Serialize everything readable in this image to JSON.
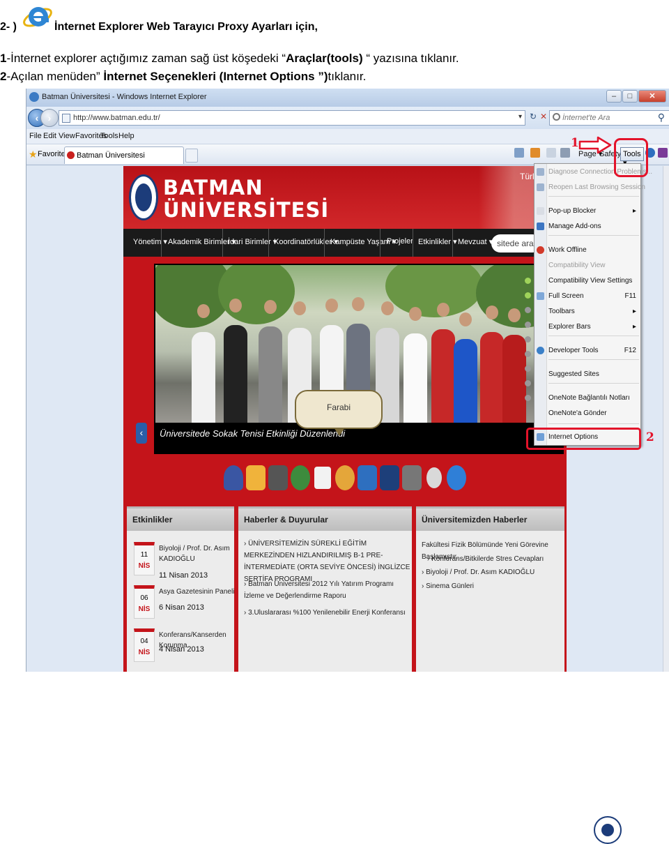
{
  "document": {
    "title_prefix": "2- )",
    "title_text": "İnternet Explorer Web Tarayıcı Proxy Ayarları için,",
    "step1_number": "1",
    "step1_text_a": "-İnternet  explorer  açtığımız zaman sağ üst köşedeki  “",
    "step1_bold": "Araçlar(tools)",
    "step1_text_b": " “ yazısına tıklanır.",
    "step2_number": "2",
    "step2_text_a": "-Açılan menüden” ",
    "step2_bold": "İnternet Seçenekleri (Internet Options ”)",
    "step2_text_b": "tıklanır."
  },
  "browser": {
    "window_title": "Batman Üniversitesi - Windows Internet Explorer",
    "url": "http://www.batman.edu.tr/",
    "search_placeholder": "İnternet'te Ara",
    "menu": [
      "File",
      "Edit",
      "View",
      "Favorites",
      "Tools",
      "Help"
    ],
    "favorites_label": "Favorites",
    "tab_label": "Batman Üniversitesi",
    "commands": {
      "page": "Page ▾",
      "safety": "Safety ▾",
      "tools": "Tools ▾"
    }
  },
  "website": {
    "brand_line1": "BATMAN",
    "brand_line2": "ÜNİVERSİTESİ",
    "language": "Türk",
    "nav": [
      "Yönetim ▾",
      "Akademik Birimler ▾",
      "İdari Birimler ▾",
      "Koordinatörlükler ▾",
      "Kampüste Yaşam ▾",
      "Projeler",
      "Etkinlikler ▾",
      "Mevzuat ▾"
    ],
    "search_placeholder": "sitede ara...",
    "slide_caption": "Üniversitede Sokak Tenisi Etkinliği Düzenlendi",
    "bubble": "Farabi",
    "panels": {
      "events_title": "Etkinlikler",
      "news_title": "Haberler & Duyurular",
      "uni_news_title": "Üniversitemizden Haberler"
    },
    "events": [
      {
        "day": "11",
        "month": "NİS",
        "title": "Biyoloji / Prof. Dr. Asım KADIOĞLU",
        "date": "11 Nisan 2013"
      },
      {
        "day": "06",
        "month": "NİS",
        "title": "Asya Gazetesinin Paneli",
        "date": "6 Nisan 2013"
      },
      {
        "day": "04",
        "month": "NİS",
        "title": "Konferans/Kanserden Korunma",
        "date": "4 Nisan 2013"
      }
    ],
    "news": [
      "› ÜNİVERSİTEMİZİN SÜREKLİ EĞİTİM MERKEZİNDEN HIZLANDIRILMIŞ B-1 PRE-İNTERMEDİATE (ORTA SEVİYE ÖNCESİ) İNGLİZCE SERTİFA PROGRAMI",
      "› Batman Üniversitesi 2012 Yılı Yatırım Programı İzleme ve Değerlendirme Raporu",
      "› 3.Uluslararası %100 Yenilenebilir Enerji Konferansı"
    ],
    "uni_news": [
      "Fakültesi Fizik Bölümünde Yeni Görevine Başlamıştır.",
      "› Konferans/Bitkilerde Stres Cevapları",
      "› Biyoloji / Prof. Dr. Asım KADIOĞLU",
      "› Sinema Günleri"
    ]
  },
  "tools_menu": {
    "items": [
      {
        "label": "Diagnose Connection Problems...",
        "disabled": true
      },
      {
        "label": "Reopen Last Browsing Session",
        "disabled": true
      },
      {
        "label": "Pop-up Blocker",
        "arrow": "▸"
      },
      {
        "label": "Manage Add-ons"
      },
      {
        "label": "Work Offline"
      },
      {
        "label": "Compatibility View",
        "disabled": true
      },
      {
        "label": "Compatibility View Settings"
      },
      {
        "label": "Full Screen",
        "shortcut": "F11"
      },
      {
        "label": "Toolbars",
        "arrow": "▸"
      },
      {
        "label": "Explorer Bars",
        "arrow": "▸"
      },
      {
        "label": "Developer Tools",
        "shortcut": "F12"
      },
      {
        "label": "Suggested Sites"
      },
      {
        "label": "OneNote Bağlantılı Notları"
      },
      {
        "label": "OneNote'a Gönder"
      },
      {
        "label": "Internet Options"
      }
    ]
  },
  "annotations": {
    "one": "1",
    "two": "2"
  }
}
